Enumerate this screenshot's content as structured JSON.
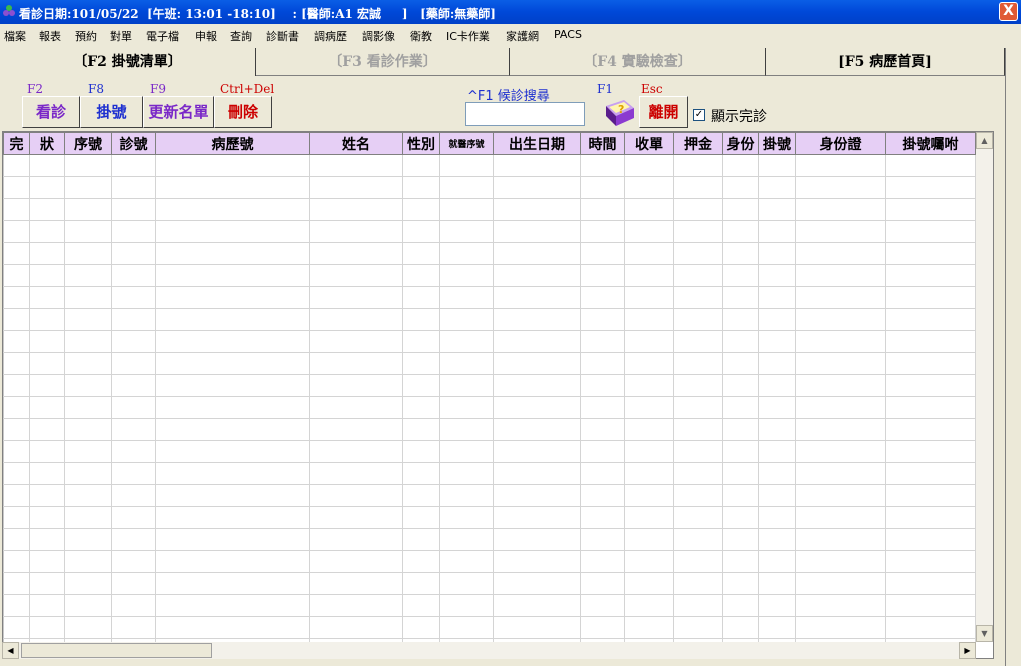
{
  "titlebar": {
    "text": "看診日期:101/05/22  [午班: 13:01 -18:10]    : [醫師:A1 宏誠     ]   [藥師:無藥師]",
    "close": "X"
  },
  "menu": [
    "檔案",
    "報表",
    "預約",
    "對單",
    "電子檔",
    "申報",
    "查詢",
    "診斷書",
    "調病歷",
    "調影像",
    "衛教",
    "IC卡作業",
    "家護網",
    "PACS"
  ],
  "tabs": [
    "〔F2 掛號清單〕",
    "〔F3 看診作業〕",
    "〔F4 實驗檢查〕",
    "[F5 病歷首頁]"
  ],
  "toolbar": {
    "keys": [
      "F2",
      "F8",
      "F9",
      "Ctrl+Del",
      "F1",
      "Esc"
    ],
    "buttons": [
      "看診",
      "掛號",
      "更新名單",
      "刪除",
      "離開"
    ],
    "search_label": "^F1 候診搜尋",
    "search_value": "",
    "show_done_label": "顯示完診",
    "show_done_checked": "✓"
  },
  "grid": {
    "columns": [
      "完",
      "狀",
      "序號",
      "診號",
      "病歷號",
      "姓名",
      "性別",
      "就醫序號",
      "出生日期",
      "時間",
      "收單",
      "押金",
      "身份",
      "掛號",
      "身份證",
      "掛號囑咐"
    ]
  },
  "colors": {
    "title_bar": "#0050e0",
    "header_bg": "#e6cff5",
    "key_purple": "#7a28c8",
    "key_blue": "#1d2fd0",
    "key_red": "#cc0000"
  }
}
